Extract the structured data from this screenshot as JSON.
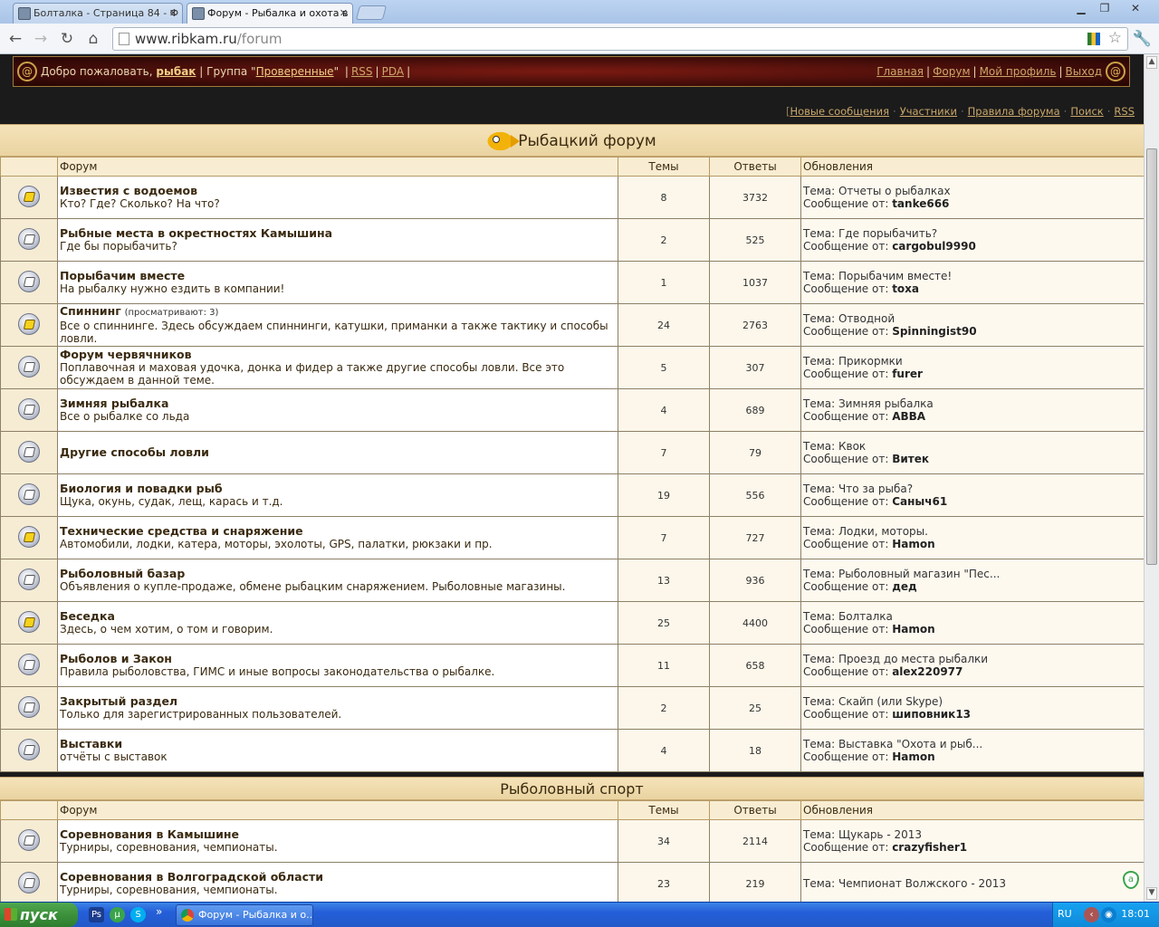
{
  "browser": {
    "tabs": [
      {
        "title": "Болталка - Страница 84 - Ф",
        "active": false
      },
      {
        "title": "Форум - Рыбалка и охота в",
        "active": true
      }
    ],
    "url_host": "www.ribkam.ru",
    "url_path": "/forum"
  },
  "header": {
    "welcome": "Добро пожаловать,",
    "username": "рыбак",
    "group_label": "| Группа \"",
    "group_name": "Проверенные",
    "group_end": "\"",
    "rss": "RSS",
    "pda": "PDA",
    "nav": [
      "Главная",
      "Форум",
      "Мой профиль",
      "Выход"
    ]
  },
  "sublinks": [
    "Новые сообщения",
    "Участники",
    "Правила форума",
    "Поиск",
    "RSS"
  ],
  "columns": {
    "forum": "Форум",
    "topics": "Темы",
    "replies": "Ответы",
    "updates": "Обновления"
  },
  "labels": {
    "topic_prefix": "Тема: ",
    "author_prefix": "Сообщение от: "
  },
  "sections": [
    {
      "title": "Рыбацкий форум",
      "forums": [
        {
          "name": "Известия с водоемов",
          "desc": "Кто? Где? Сколько? На что?",
          "viewing": "",
          "topics": "8",
          "replies": "3732",
          "last_topic": "Отчеты о рыбалках",
          "last_user": "tanke666",
          "new": true
        },
        {
          "name": "Рыбные места в окрестностях Камышина",
          "desc": "Где бы порыбачить?",
          "viewing": "",
          "topics": "2",
          "replies": "525",
          "last_topic": "Где порыбачить?",
          "last_user": "cargobul9990",
          "new": false
        },
        {
          "name": "Порыбачим вместе",
          "desc": "На рыбалку нужно ездить в компании!",
          "viewing": "",
          "topics": "1",
          "replies": "1037",
          "last_topic": "Порыбачим вместе!",
          "last_user": "toxa",
          "new": false
        },
        {
          "name": "Спиннинг",
          "desc": "Все о спиннинге. Здесь обсуждаем спиннинги, катушки, приманки а также тактику и способы ловли.",
          "viewing": "(просматривают: 3)",
          "topics": "24",
          "replies": "2763",
          "last_topic": "Отводной",
          "last_user": "Spinningist90",
          "new": true
        },
        {
          "name": "Форум червячников",
          "desc": "Поплавочная и маховая удочка, донка и фидер а также другие способы ловли. Все это обсуждаем в данной теме.",
          "viewing": "",
          "topics": "5",
          "replies": "307",
          "last_topic": "Прикормки",
          "last_user": "furer",
          "new": false
        },
        {
          "name": "Зимняя рыбалка",
          "desc": "Все о рыбалке со льда",
          "viewing": "",
          "topics": "4",
          "replies": "689",
          "last_topic": "Зимняя рыбалка",
          "last_user": "ABBA",
          "new": false
        },
        {
          "name": "Другие способы ловли",
          "desc": "",
          "viewing": "",
          "topics": "7",
          "replies": "79",
          "last_topic": "Квок",
          "last_user": "Витек",
          "new": false
        },
        {
          "name": "Биология и повадки рыб",
          "desc": "Щука, окунь, судак, лещ, карась и т.д.",
          "viewing": "",
          "topics": "19",
          "replies": "556",
          "last_topic": "Что за рыба?",
          "last_user": "Саныч61",
          "new": false
        },
        {
          "name": "Технические средства и снаряжение",
          "desc": "Автомобили, лодки, катера, моторы, эхолоты, GPS, палатки, рюкзаки и пр.",
          "viewing": "",
          "topics": "7",
          "replies": "727",
          "last_topic": "Лодки, моторы.",
          "last_user": "Hamon",
          "new": true
        },
        {
          "name": "Рыболовный базар",
          "desc": "Объявления о купле-продаже, обмене рыбацким снаряжением. Рыболовные магазины.",
          "viewing": "",
          "topics": "13",
          "replies": "936",
          "last_topic": "Рыболовный магазин \"Пес...",
          "last_user": "дед",
          "new": false
        },
        {
          "name": "Беседка",
          "desc": "Здесь, о чем хотим, о том и говорим.",
          "viewing": "",
          "topics": "25",
          "replies": "4400",
          "last_topic": "Болталка",
          "last_user": "Hamon",
          "new": true
        },
        {
          "name": "Рыболов и Закон",
          "desc": "Правила рыболовства, ГИМС и иные вопросы законодательства о рыбалке.",
          "viewing": "",
          "topics": "11",
          "replies": "658",
          "last_topic": "Проезд до места рыбалки",
          "last_user": "alex220977",
          "new": false
        },
        {
          "name": "Закрытый раздел",
          "desc": "Только для зарегистрированных пользователей.",
          "viewing": "",
          "topics": "2",
          "replies": "25",
          "last_topic": "Скайп (или Skype)",
          "last_user": "шиповник13",
          "new": false
        },
        {
          "name": "Выставки",
          "desc": "отчёты с выставок",
          "viewing": "",
          "topics": "4",
          "replies": "18",
          "last_topic": "Выставка \"Охота и рыб...",
          "last_user": "Hamon",
          "new": false
        }
      ]
    },
    {
      "title": "Рыболовный спорт",
      "forums": [
        {
          "name": "Соревнования в Камышине",
          "desc": "Турниры, соревнования, чемпионаты.",
          "viewing": "",
          "topics": "34",
          "replies": "2114",
          "last_topic": "Щукарь - 2013",
          "last_user": "crazyfisher1",
          "new": false
        },
        {
          "name": "Соревнования в Волгоградской области",
          "desc": "Турниры, соревнования, чемпионаты.",
          "viewing": "",
          "topics": "23",
          "replies": "219",
          "last_topic": "Чемпионат Волжского - 2013",
          "last_user": "",
          "new": false
        }
      ]
    }
  ],
  "taskbar": {
    "start": "пуск",
    "task": "Форум - Рыбалка и о...",
    "lang": "RU",
    "clock": "18:01"
  }
}
